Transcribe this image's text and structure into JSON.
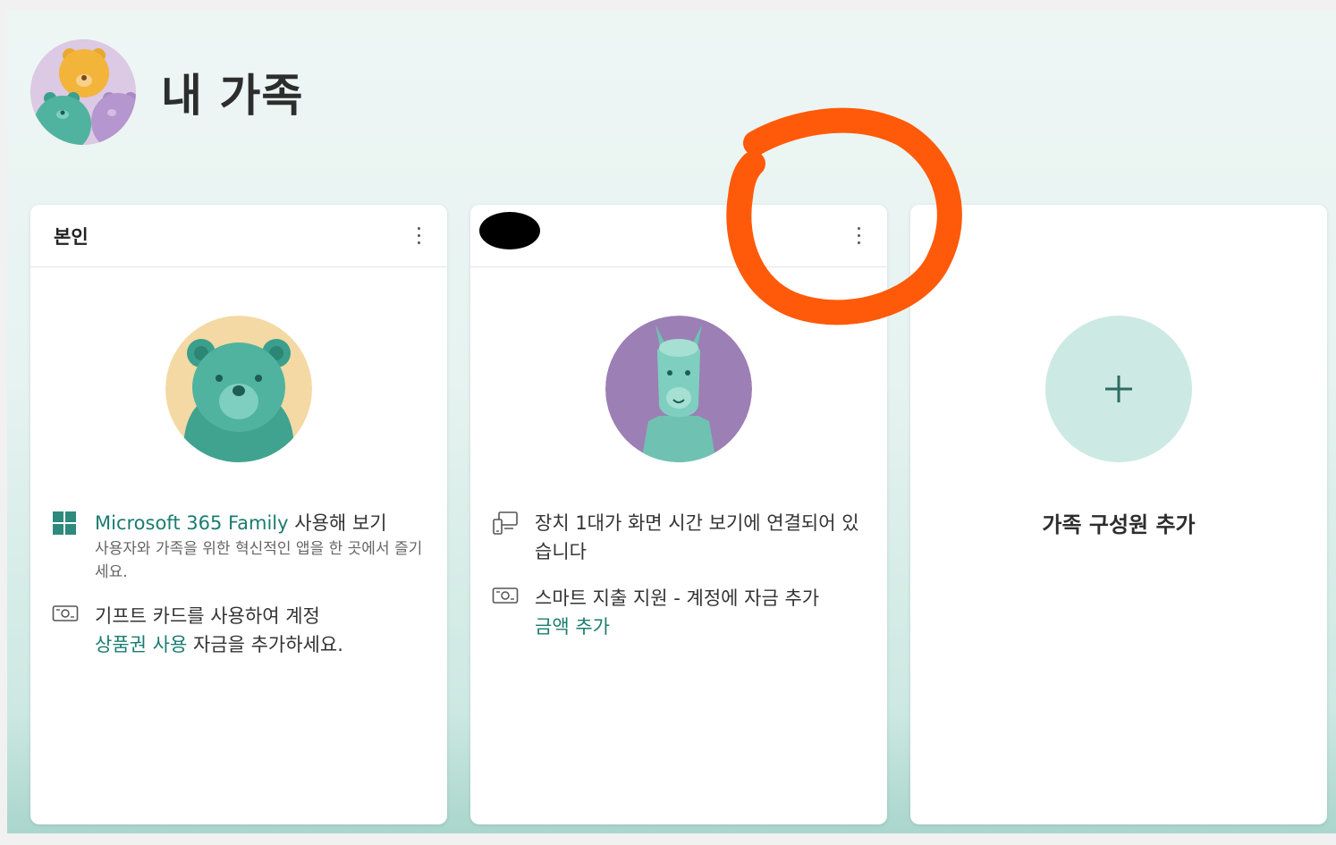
{
  "header": {
    "title": "내 가족",
    "avatar_icon": "family-bears-avatar"
  },
  "cards": [
    {
      "name": "본인",
      "avatar_icon": "bear-avatar",
      "avatar_bg": "#f4d9a4",
      "items": [
        {
          "icon": "microsoft-365-icon",
          "link_text": "Microsoft 365 Family",
          "text": " 사용해 보기",
          "sub": "사용자와 가족을 위한 혁신적인 앱을 한 곳에서 즐기세요."
        },
        {
          "icon": "gift-card-icon",
          "text": "기프트 카드를 사용하여 계정",
          "link_text": "상품권 사용",
          "text_after": " 자금을 추가하세요."
        }
      ]
    },
    {
      "name": "",
      "avatar_icon": "llama-avatar",
      "avatar_bg": "#9c7fb4",
      "items": [
        {
          "icon": "devices-icon",
          "text": "장치 1대가 화면 시간 보기에 연결되어 있습니다"
        },
        {
          "icon": "money-icon",
          "text": "스마트 지출 지원 - 계정에 자금 추가",
          "link_text": "금액 추가"
        }
      ]
    },
    {
      "add_label": "가족 구성원 추가",
      "add_icon": "plus-icon"
    }
  ],
  "colors": {
    "accent": "#1b7c70",
    "annotation": "#ff5a0a"
  }
}
